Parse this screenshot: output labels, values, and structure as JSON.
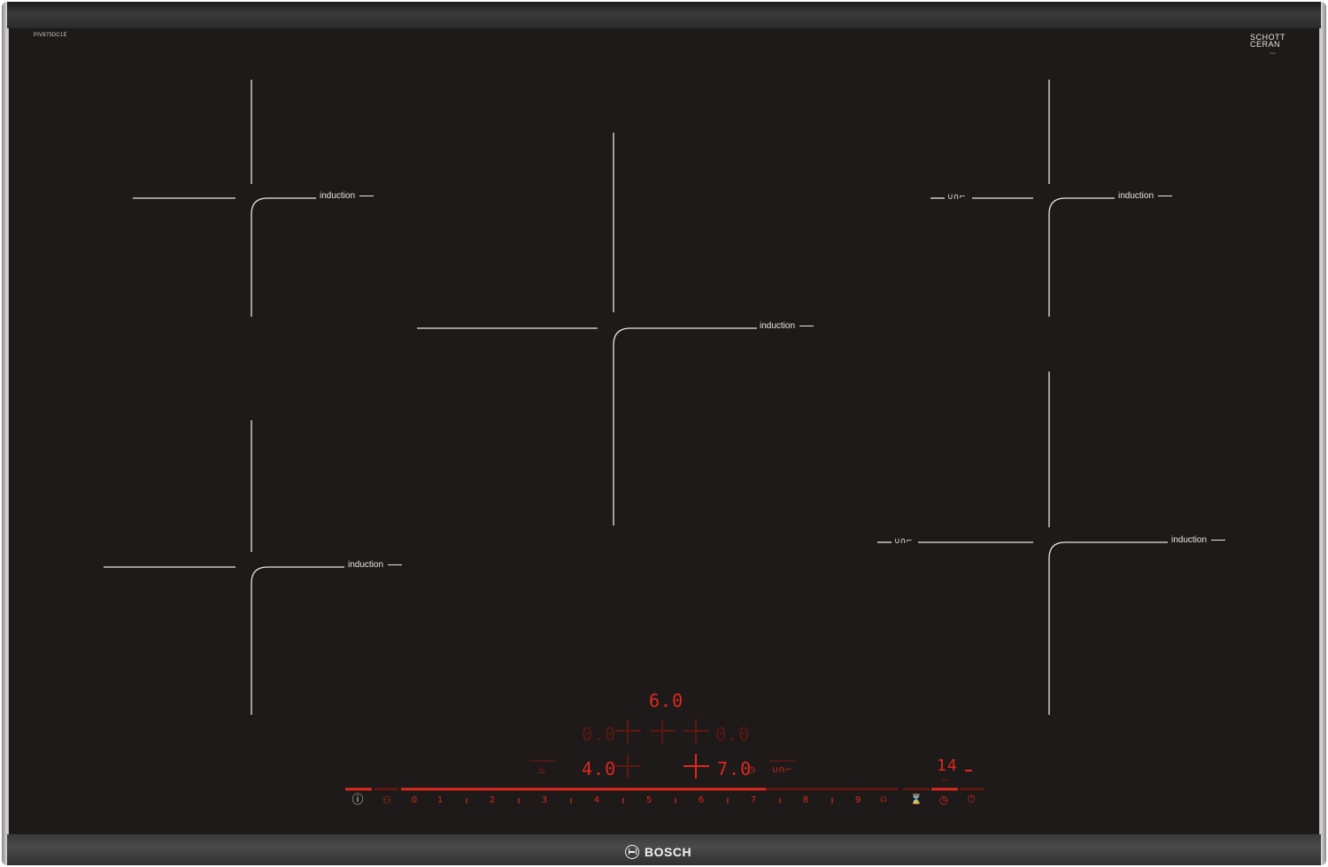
{
  "appliance": {
    "model_code": "PIV875DC1E",
    "glass_brand": "SCHOTT CERAN",
    "brand": "BOSCH"
  },
  "zones": [
    {
      "id": "front-left",
      "label": "induction"
    },
    {
      "id": "rear-left",
      "label": "induction"
    },
    {
      "id": "center",
      "label": "induction"
    },
    {
      "id": "rear-right",
      "label": "induction",
      "mode_symbol": "∪∩⌐"
    },
    {
      "id": "front-right",
      "label": "induction",
      "mode_symbol": "∪∩⌐"
    }
  ],
  "display": {
    "center_power": "6.0",
    "rear_left_power": "0.0",
    "rear_right_power": "0.0",
    "front_left_power": "4.0",
    "front_right_power": "7.0",
    "timer": "14"
  },
  "controls": {
    "scale": [
      "0",
      "1",
      "2",
      "3",
      "4",
      "5",
      "6",
      "7",
      "8",
      "9"
    ],
    "icons": [
      "power-icon",
      "child-lock-icon",
      "boost-icon",
      "wipe-protection-icon",
      "timer-icon",
      "stopwatch-icon",
      "frying-sensor-icon",
      "flex-zone-icon"
    ]
  },
  "colors": {
    "glass": "#1d1a19",
    "led_active": "#e0281f",
    "led_dim": "#5e1812",
    "print": "#e8e8e8"
  }
}
